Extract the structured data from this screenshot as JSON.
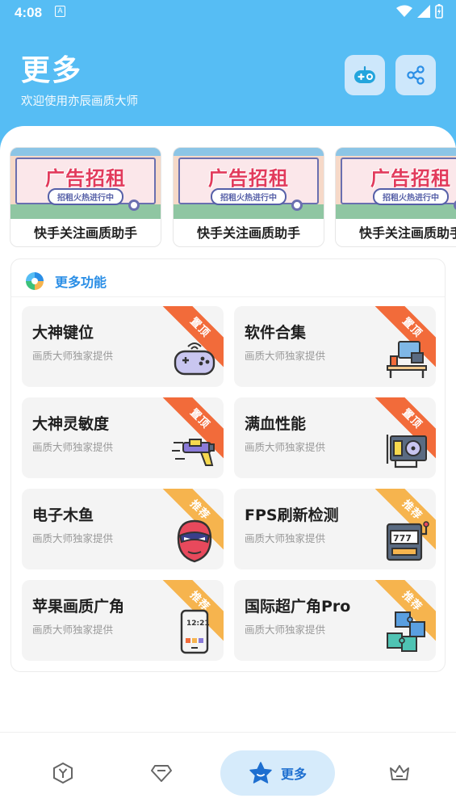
{
  "status_bar": {
    "time": "4:08",
    "notif_letter": "A"
  },
  "header": {
    "title": "更多",
    "subtitle": "欢迎使用亦辰画质大师",
    "game_button_icon": "gamepad-icon",
    "share_button_icon": "share-icon"
  },
  "banners": [
    {
      "ad_title": "广告招租",
      "ad_pill": "招租火热进行中",
      "label": "快手关注画质助手"
    },
    {
      "ad_title": "广告招租",
      "ad_pill": "招租火热进行中",
      "label": "快手关注画质助手"
    },
    {
      "ad_title": "广告招租",
      "ad_pill": "招租火热进行中",
      "label": "快手关注画质助手"
    }
  ],
  "functions": {
    "title": "更多功能",
    "items": [
      {
        "title": "大神键位",
        "subtitle": "画质大师独家提供",
        "badge": "置顶",
        "icon": "gamepad-icon"
      },
      {
        "title": "软件合集",
        "subtitle": "画质大师独家提供",
        "badge": "置顶",
        "icon": "desk-computer-icon"
      },
      {
        "title": "大神灵敏度",
        "subtitle": "画质大师独家提供",
        "badge": "置顶",
        "icon": "blaster-gun-icon"
      },
      {
        "title": "满血性能",
        "subtitle": "画质大师独家提供",
        "badge": "置顶",
        "icon": "graphics-card-icon"
      },
      {
        "title": "电子木鱼",
        "subtitle": "画质大师独家提供",
        "badge": "推荐",
        "icon": "hero-mask-icon"
      },
      {
        "title": "FPS刷新检测",
        "subtitle": "画质大师独家提供",
        "badge": "推荐",
        "icon": "slot-machine-icon"
      },
      {
        "title": "苹果画质广角",
        "subtitle": "画质大师独家提供",
        "badge": "推荐",
        "icon": "phone-clock-icon",
        "phone_time": "12:21"
      },
      {
        "title": "国际超广角Pro",
        "subtitle": "画质大师独家提供",
        "badge": "推荐",
        "icon": "puzzle-icon"
      }
    ]
  },
  "bottom_nav": {
    "items": [
      {
        "icon": "hexagon-y-icon"
      },
      {
        "icon": "diamond-icon"
      },
      {
        "icon": "star-icon",
        "label": "更多",
        "active": true
      },
      {
        "icon": "crown-icon"
      }
    ]
  },
  "colors": {
    "header_bg": "#56bdf4",
    "accent": "#2a8ee6",
    "ribbon_top": "#f26b3a",
    "ribbon_recommend": "#f6b44e"
  }
}
